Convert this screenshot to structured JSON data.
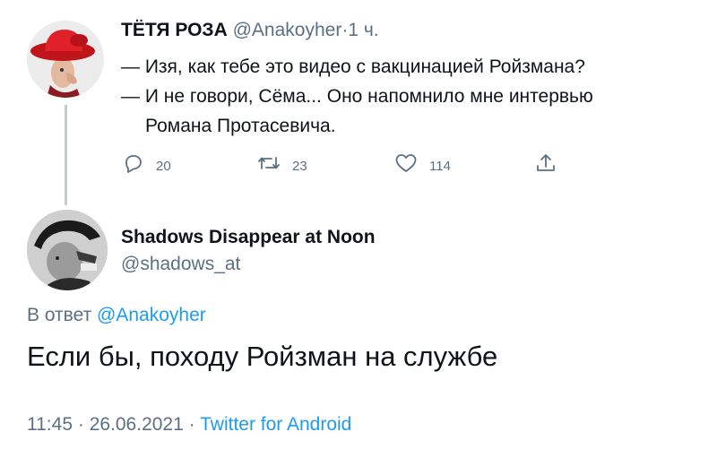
{
  "parent_tweet": {
    "author_name": "ТЁТЯ РОЗА",
    "author_handle": "@Anakoyher",
    "separator": "·",
    "time_ago": "1 ч.",
    "lines": [
      "— Изя, как тебе это видео с вакцинацией Ройзмана?",
      "— И не говори, Сёма... Оно напомнило мне интервью",
      "Романа Протасевича."
    ],
    "actions": {
      "reply_count": "20",
      "retweet_count": "23",
      "like_count": "114",
      "reply_icon": "reply-icon",
      "retweet_icon": "retweet-icon",
      "like_icon": "heart-icon",
      "share_icon": "share-icon"
    }
  },
  "main_tweet": {
    "author_name": "Shadows Disappear at Noon",
    "author_handle": "@shadows_at",
    "replying_label": "В ответ",
    "replying_to": "@Anakoyher",
    "text": "Если бы, походу Ройзман на службе",
    "time": "11:45",
    "separator": "·",
    "date": "26.06.2021",
    "source": "Twitter for Android"
  },
  "colors": {
    "text": "#0f1419",
    "secondary": "#5b7083",
    "link": "#1d9bf0",
    "thread_line": "#c4ccd3"
  }
}
